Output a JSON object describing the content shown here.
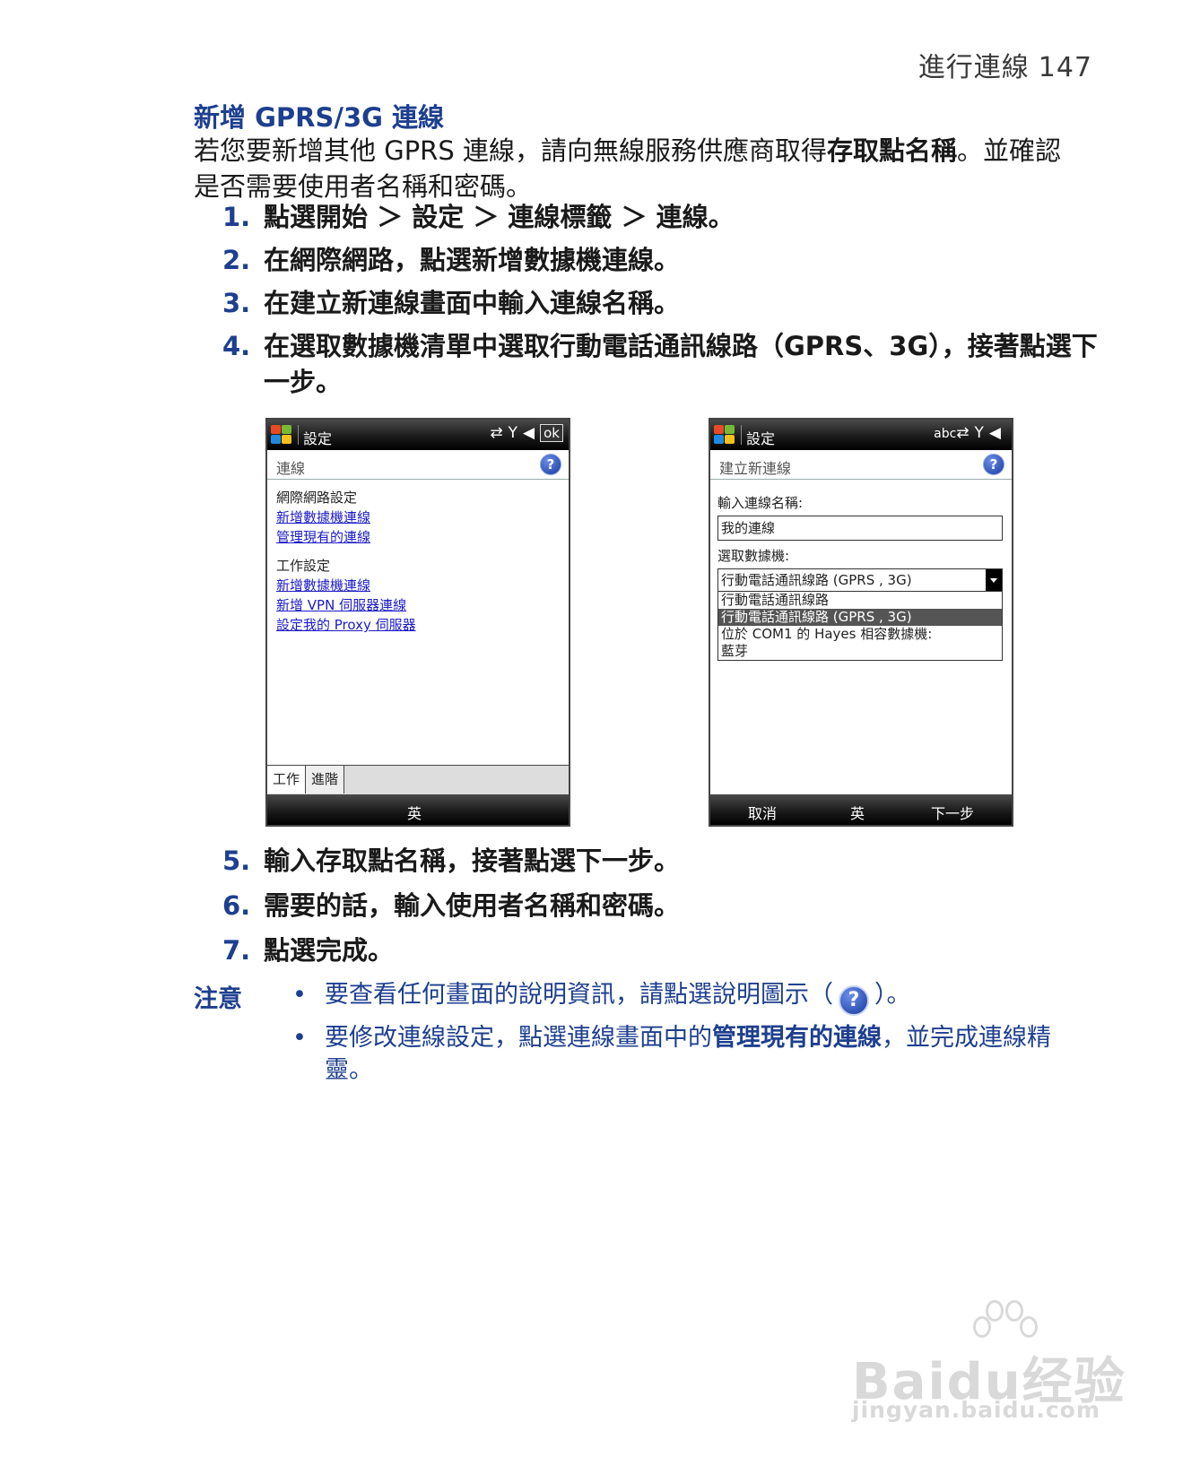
{
  "header": {
    "chapter": "進行連線",
    "page_number": "147"
  },
  "section": {
    "title": "新增 GPRS/3G 連線",
    "intro_1": "若您要新增其他 GPRS 連線，請向無線服務供應商取得",
    "intro_bold": "存取點名稱",
    "intro_2": "。並確認是否需要使用者名稱和密碼。"
  },
  "steps": [
    {
      "num": "1.",
      "text": "點選開始 ＞ 設定 ＞ 連線標籤 ＞ 連線。"
    },
    {
      "num": "2.",
      "text": "在網際網路，點選新增數據機連線。"
    },
    {
      "num": "3.",
      "text": "在建立新連線畫面中輸入連線名稱。"
    },
    {
      "num": "4.",
      "text": "在選取數據機清單中選取行動電話通訊線路（GPRS、3G），接著點選下一步。"
    },
    {
      "num": "5.",
      "text": "輸入存取點名稱，接著點選下一步。"
    },
    {
      "num": "6.",
      "text": "需要的話，輸入使用者名稱和密碼。"
    },
    {
      "num": "7.",
      "text": "點選完成。"
    }
  ],
  "screen1": {
    "title": "設定",
    "ok": "ok",
    "subtitle": "連線",
    "help": "?",
    "group1_label": "網際網路設定",
    "group1_links": [
      "新增數據機連線",
      "管理現有的連線"
    ],
    "group2_label": "工作設定",
    "group2_links": [
      "新增數據機連線",
      "新增 VPN 伺服器連線",
      "設定我的 Proxy 伺服器"
    ],
    "tabs": [
      "工作",
      "進階"
    ],
    "softkey_center": "英"
  },
  "screen2": {
    "title": "設定",
    "abc": "abc",
    "subtitle": "建立新連線",
    "help": "?",
    "name_label": "輸入連線名稱:",
    "name_value": "我的連線",
    "modem_label": "選取數據機:",
    "modem_value": "行動電話通訊線路 (GPRS , 3G)",
    "options": [
      "行動電話通訊線路",
      "行動電話通訊線路 (GPRS , 3G)",
      "位於 COM1 的 Hayes 相容數據機:",
      "藍芽"
    ],
    "softkey_left": "取消",
    "softkey_center": "英",
    "softkey_right": "下一步"
  },
  "note": {
    "label": "注意",
    "bullet_symbol": "•",
    "b1_pre": "要查看任何畫面的說明資訊，請點選說明圖示（",
    "b1_icon": "?",
    "b1_post": "）。",
    "b2_pre": "要修改連線設定，點選連線畫面中的",
    "b2_bold": "管理現有的連線",
    "b2_post": "，並完成連線精靈。"
  },
  "watermark": {
    "brand": "Baidu经验",
    "url": "jingyan.baidu.com"
  }
}
